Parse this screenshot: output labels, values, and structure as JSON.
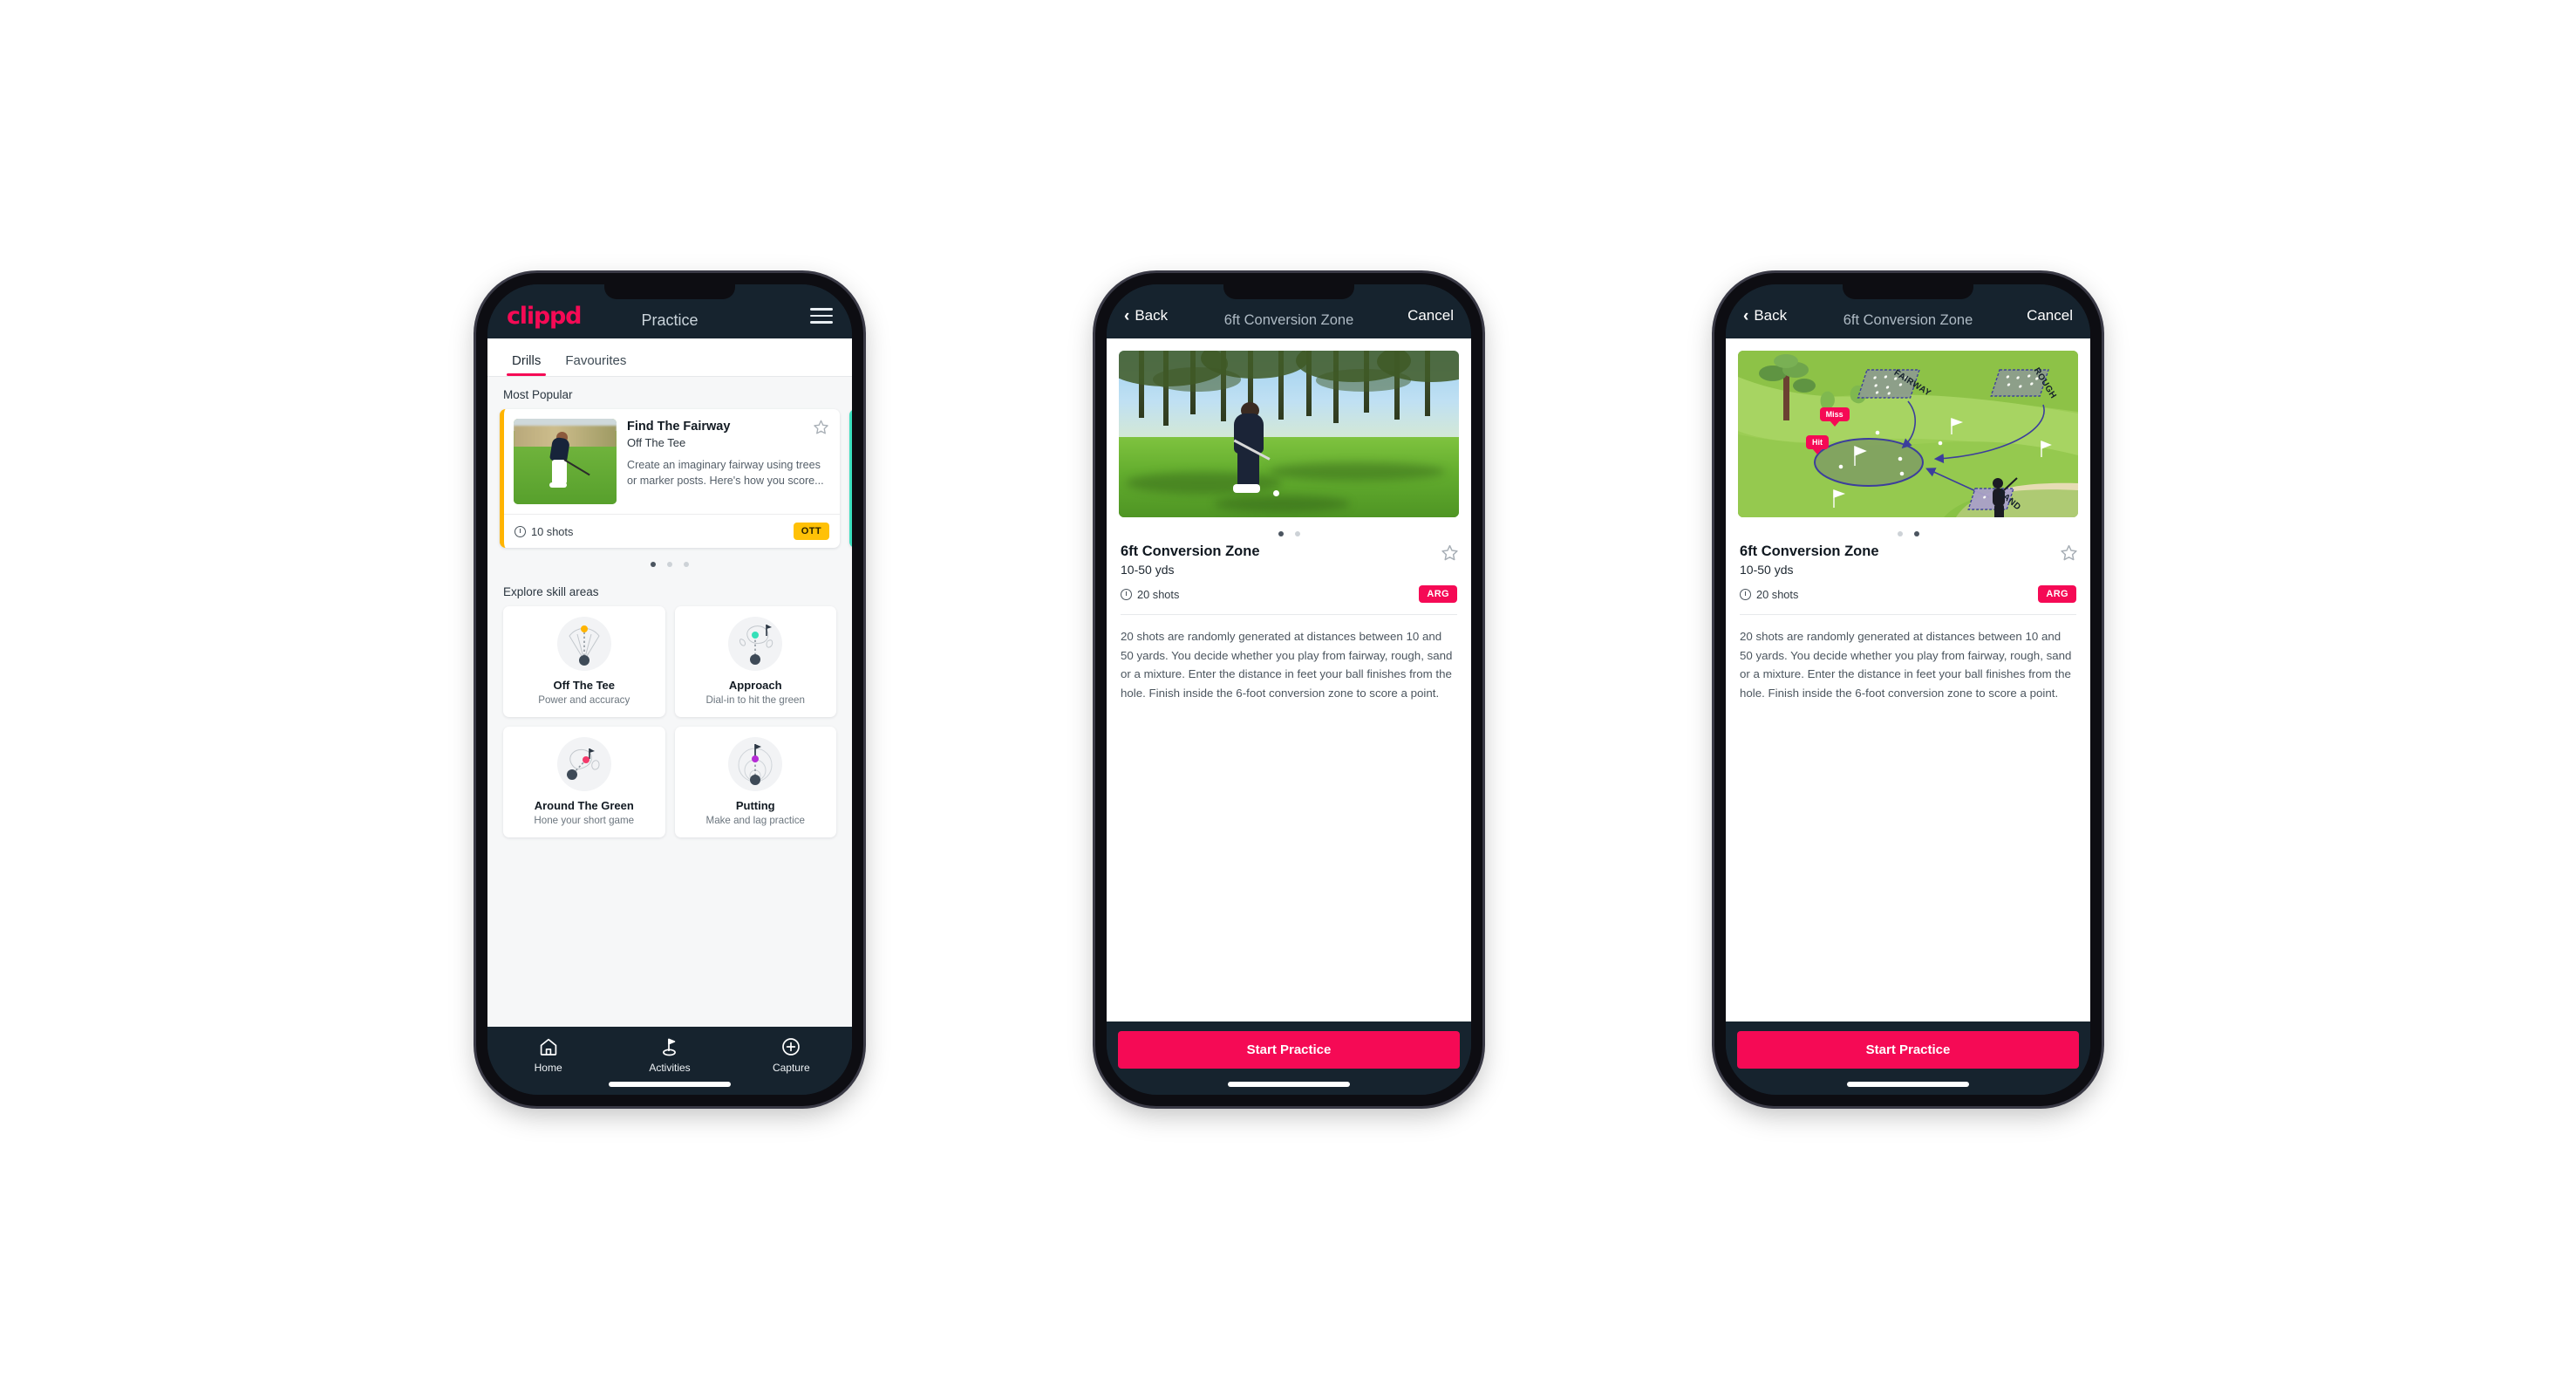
{
  "app": {
    "logo_text": "clippd",
    "brand_pink": "#F50A55",
    "header_navy": "#16232E",
    "accent_amber": "#FFC107",
    "accent_teal": "#3DE0C0"
  },
  "phone1": {
    "appbar": {
      "logo": "clippd",
      "title": "Practice",
      "menu_icon": "hamburger-menu-icon"
    },
    "tabs": [
      {
        "label": "Drills",
        "active": true
      },
      {
        "label": "Favourites",
        "active": false
      }
    ],
    "most_popular": {
      "section_label": "Most Popular",
      "card": {
        "title": "Find The Fairway",
        "subtitle": "Off The Tee",
        "description": "Create an imaginary fairway using trees or marker posts. Here's how you score...",
        "shots": "10 shots",
        "badge": "OTT",
        "badge_color": "#FFC107",
        "accent_color": "#FFB400",
        "star_icon": "star-outline-icon",
        "clock_icon": "clock-icon"
      },
      "next_card_accent": "#3DE0C0",
      "dots": {
        "count": 3,
        "active_index": 0
      }
    },
    "skills": {
      "section_label": "Explore skill areas",
      "items": [
        {
          "name": "Off The Tee",
          "desc": "Power and accuracy",
          "icon": "off-the-tee-icon",
          "dot_color": "#FFB400"
        },
        {
          "name": "Approach",
          "desc": "Dial-in to hit the green",
          "icon": "approach-icon",
          "dot_color": "#35E0B8"
        },
        {
          "name": "Around The Green",
          "desc": "Hone your short game",
          "icon": "around-the-green-icon",
          "dot_color": "#F43A6B"
        },
        {
          "name": "Putting",
          "desc": "Make and lag practice",
          "icon": "putting-icon",
          "dot_color": "#B62BD6"
        }
      ]
    },
    "tabbar": [
      {
        "label": "Home",
        "icon": "home-icon",
        "active": false
      },
      {
        "label": "Activities",
        "icon": "golf-flag-icon",
        "active": true
      },
      {
        "label": "Capture",
        "icon": "plus-circle-icon",
        "active": false
      }
    ]
  },
  "phone2": {
    "navbar": {
      "back": "Back",
      "title": "6ft Conversion Zone",
      "cancel": "Cancel",
      "back_icon": "chevron-left-icon"
    },
    "media_kind": "photo-golfer-chipping",
    "dots": {
      "count": 2,
      "active_index": 0
    },
    "detail": {
      "title": "6ft Conversion Zone",
      "yards": "10-50 yds",
      "shots": "20 shots",
      "badge": "ARG",
      "badge_color": "#F50A55",
      "star_icon": "star-outline-icon",
      "clock_icon": "clock-icon",
      "description": "20 shots are randomly generated at distances between 10 and 50 yards. You decide whether you play from fairway, rough, sand or a mixture. Enter the distance in feet your ball finishes from the hole. Finish inside the 6-foot conversion zone to score a point."
    },
    "cta": "Start Practice"
  },
  "phone3": {
    "navbar": {
      "back": "Back",
      "title": "6ft Conversion Zone",
      "cancel": "Cancel",
      "back_icon": "chevron-left-icon"
    },
    "media_kind": "course-diagram",
    "course": {
      "zone_labels": [
        "FAIRWAY",
        "ROUGH",
        "SAND"
      ],
      "markers": [
        "Miss",
        "Hit"
      ],
      "marker_color": "#F4375F"
    },
    "dots": {
      "count": 2,
      "active_index": 1
    },
    "detail": {
      "title": "6ft Conversion Zone",
      "yards": "10-50 yds",
      "shots": "20 shots",
      "badge": "ARG",
      "badge_color": "#F50A55",
      "star_icon": "star-outline-icon",
      "clock_icon": "clock-icon",
      "description": "20 shots are randomly generated at distances between 10 and 50 yards. You decide whether you play from fairway, rough, sand or a mixture. Enter the distance in feet your ball finishes from the hole. Finish inside the 6-foot conversion zone to score a point."
    },
    "cta": "Start Practice"
  }
}
